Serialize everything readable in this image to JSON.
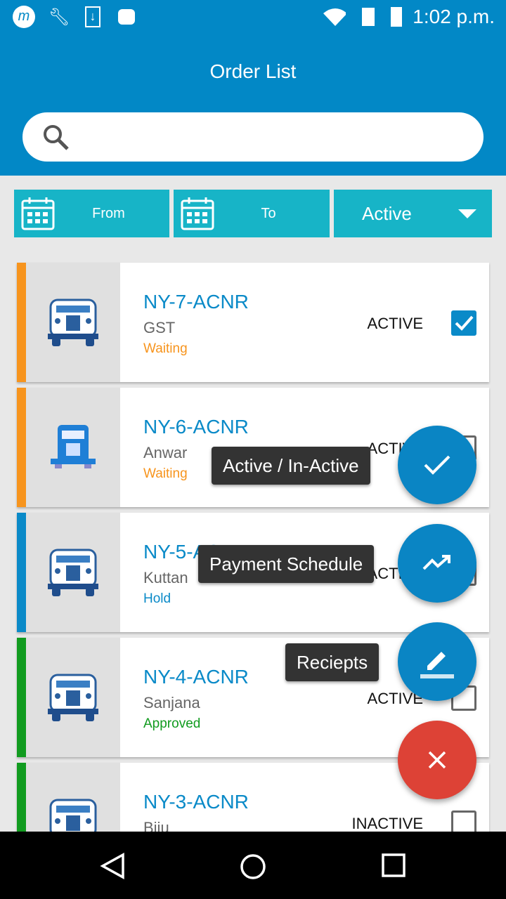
{
  "status_bar": {
    "time": "1:02 p.m.",
    "icons": [
      "moto-icon",
      "wrench-icon",
      "download-icon",
      "android-icon",
      "wifi-icon",
      "sim-off-icon",
      "battery-charging-icon"
    ]
  },
  "header": {
    "title": "Order List"
  },
  "search": {
    "placeholder": "",
    "value": ""
  },
  "filters": {
    "from": "From",
    "to": "To",
    "status": "Active"
  },
  "orders": [
    {
      "code": "NY-7-ACNR",
      "name": "GST",
      "status": "Waiting",
      "status_color": "#f7941d",
      "state": "ACTIVE",
      "checked": true,
      "icon": "bus-icon"
    },
    {
      "code": "NY-6-ACNR",
      "name": "Anwar",
      "status": "Waiting",
      "status_color": "#f7941d",
      "state": "ACTIVE",
      "checked": false,
      "icon": "truck-icon"
    },
    {
      "code": "NY-5-ACNR",
      "name": "Kuttan",
      "status": "Hold",
      "status_color": "#0a8ac8",
      "state": "ACTIVE",
      "checked": false,
      "icon": "bus-icon"
    },
    {
      "code": "NY-4-ACNR",
      "name": "Sanjana",
      "status": "Approved",
      "status_color": "#119b1f",
      "state": "ACTIVE",
      "checked": false,
      "icon": "bus-icon"
    },
    {
      "code": "NY-3-ACNR",
      "name": "Biju",
      "status": "",
      "status_color": "#119b1f",
      "state": "INACTIVE",
      "checked": false,
      "icon": "bus-icon"
    }
  ],
  "fab_menu": {
    "active_inactive": "Active / In-Active",
    "payment_schedule": "Payment Schedule",
    "receipts": "Reciepts"
  },
  "colors": {
    "primary": "#0288c6",
    "filter": "#17b4c7",
    "close": "#dd4236"
  }
}
